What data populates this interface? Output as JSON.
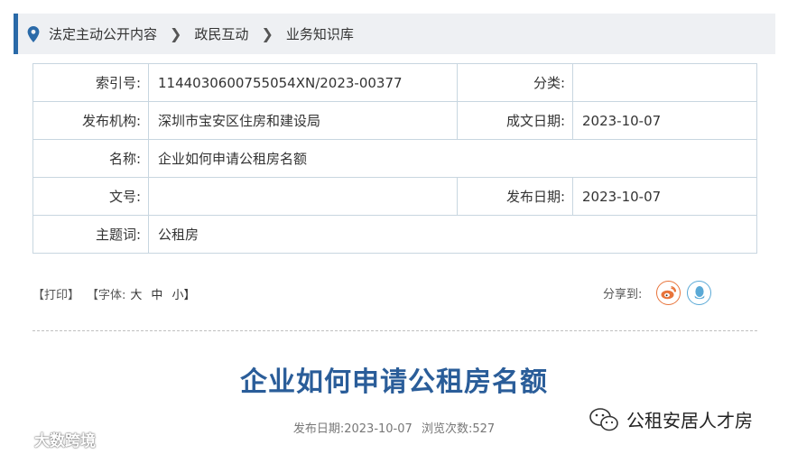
{
  "breadcrumb": {
    "items": [
      "法定主动公开内容",
      "政民互动",
      "业务知识库"
    ]
  },
  "meta": {
    "index_label": "索引号:",
    "index_value": "1144030600755054XN/2023-00377",
    "category_label": "分类:",
    "category_value": "",
    "publisher_label": "发布机构:",
    "publisher_value": "深圳市宝安区住房和建设局",
    "created_label": "成文日期:",
    "created_value": "2023-10-07",
    "name_label": "名称:",
    "name_value": "企业如何申请公租房名额",
    "docno_label": "文号:",
    "docno_value": "",
    "published_label": "发布日期:",
    "published_value": "2023-10-07",
    "keyword_label": "主题词:",
    "keyword_value": "公租房"
  },
  "tools": {
    "print": "【打印】",
    "font_prefix": "【字体:",
    "font_large": "大",
    "font_medium": "中",
    "font_small": "小】",
    "share_label": "分享到:"
  },
  "article": {
    "title": "企业如何申请公租房名额",
    "pub_date": "发布日期:2023-10-07",
    "views": "浏览次数:527"
  },
  "watermark": {
    "left": "大数跨境",
    "right": "公租安居人才房"
  },
  "colors": {
    "accent": "#2a6aa8",
    "title": "#2a5d99",
    "weibo": "#e8743b",
    "qq": "#5aa9d6"
  }
}
